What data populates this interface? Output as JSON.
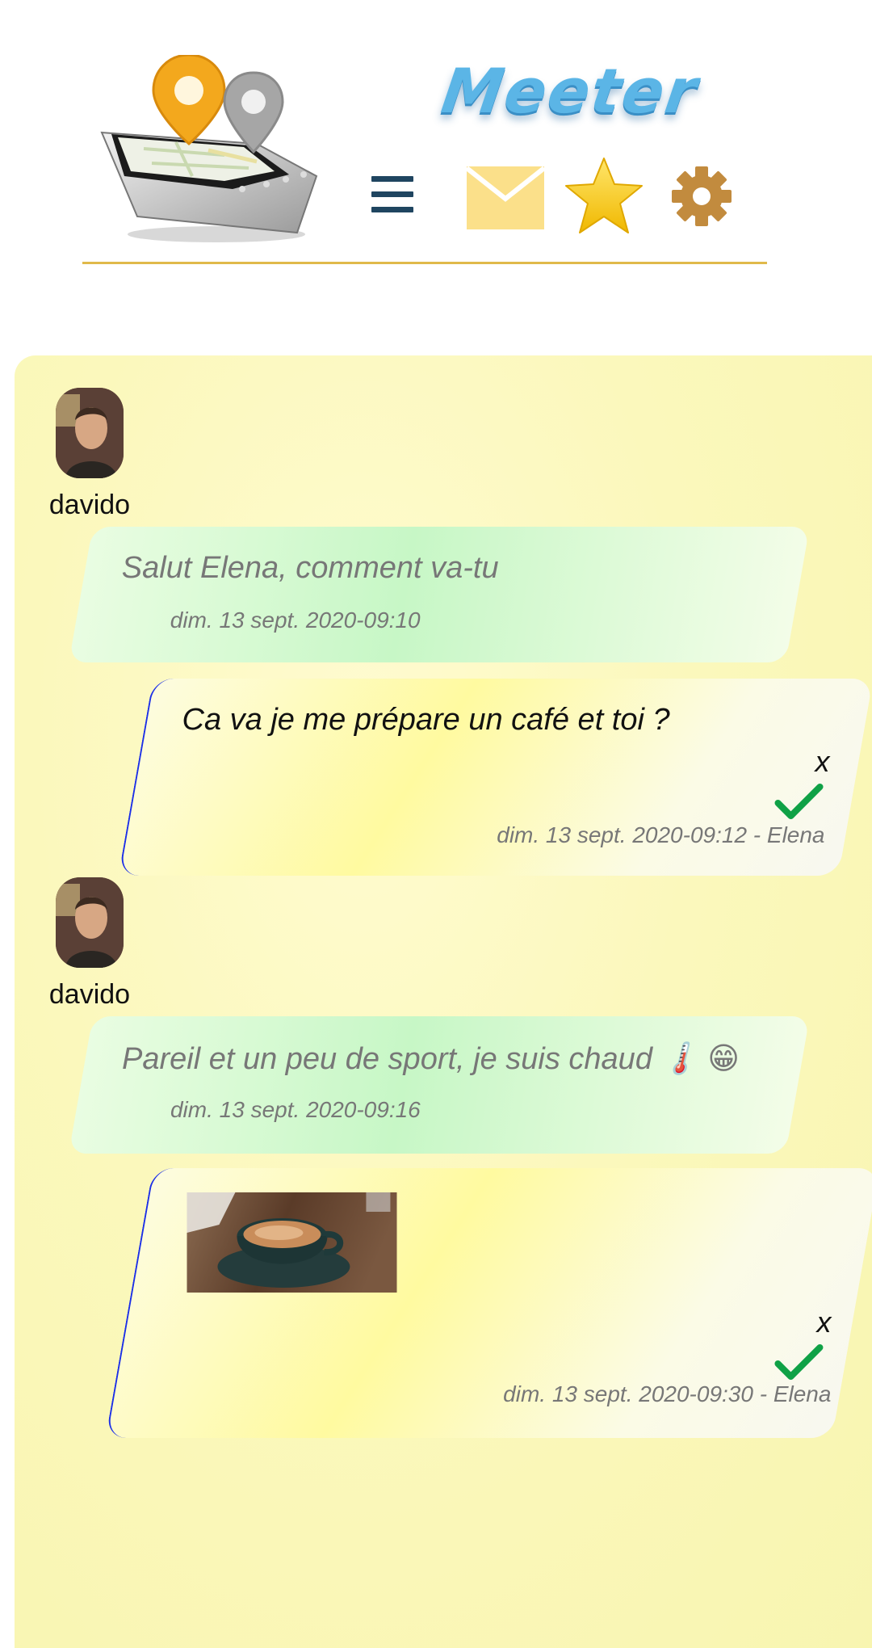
{
  "header": {
    "brand": "Meeter",
    "icons": [
      "menu-icon",
      "mail-icon",
      "star-icon",
      "gear-icon"
    ],
    "colors": {
      "menu": "#1f4560",
      "mail": "#fbe08a",
      "star": "#f5c518",
      "gear": "#c28b3e",
      "rule": "#e0b94a"
    }
  },
  "messages": [
    {
      "type": "received",
      "author": "davido",
      "text": "Salut Elena, comment va-tu",
      "time": "dim. 13 sept. 2020-09:10"
    },
    {
      "type": "sent",
      "text": "Ca va je me prépare un café et toi ?",
      "delete": "x",
      "time": "dim. 13 sept. 2020-09:12 - Elena"
    },
    {
      "type": "received",
      "author": "davido",
      "text": "Pareil et un peu de sport, je suis chaud 🌡️ 😁",
      "time": "dim. 13 sept. 2020-09:16"
    },
    {
      "type": "sent",
      "image": "coffee-photo",
      "delete": "x",
      "time": "dim. 13 sept. 2020-09:30 - Elena"
    }
  ]
}
